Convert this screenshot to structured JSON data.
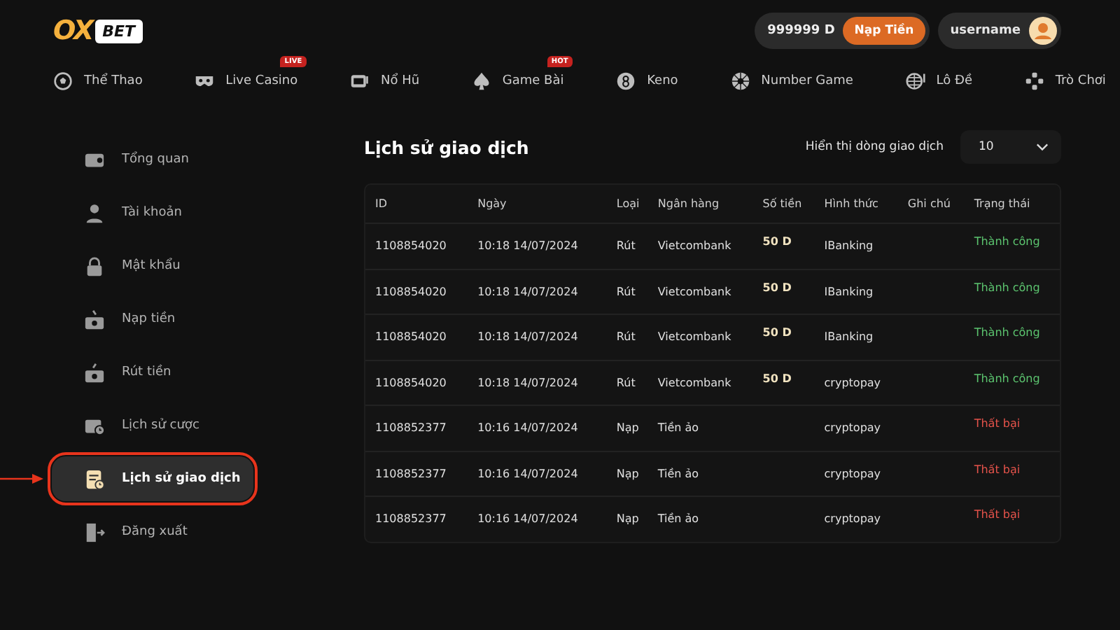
{
  "logo": {
    "first": "OX",
    "second": "BET"
  },
  "balance": {
    "amount": "999999 D",
    "deposit_button": "Nạp Tiền"
  },
  "user": {
    "name": "username"
  },
  "nav": [
    {
      "label": "Thể Thao"
    },
    {
      "label": "Live Casino",
      "badge": "LIVE"
    },
    {
      "label": "Nổ Hũ"
    },
    {
      "label": "Game Bài",
      "badge": "HOT"
    },
    {
      "label": "Keno"
    },
    {
      "label": "Number Game"
    },
    {
      "label": "Lô Đề"
    },
    {
      "label": "Trò Chơi"
    }
  ],
  "sidebar": {
    "items": [
      {
        "label": "Tổng quan",
        "selected": false,
        "highlighted": false
      },
      {
        "label": "Tài khoản",
        "selected": false,
        "highlighted": false
      },
      {
        "label": "Mật khẩu",
        "selected": false,
        "highlighted": false
      },
      {
        "label": "Nạp tiền",
        "selected": false,
        "highlighted": false
      },
      {
        "label": "Rút tiền",
        "selected": false,
        "highlighted": false
      },
      {
        "label": "Lịch sử cược",
        "selected": false,
        "highlighted": false
      },
      {
        "label": "Lịch sử giao dịch",
        "selected": true,
        "highlighted": true
      },
      {
        "label": "Đăng xuất",
        "selected": false,
        "highlighted": false
      }
    ]
  },
  "page_title": "Lịch sử giao dịch",
  "rows_per_page": {
    "label": "Hiển thị dòng giao dịch",
    "value": "10"
  },
  "table": {
    "columns": [
      "ID",
      "Ngày",
      "Loại",
      "Ngân hàng",
      "Số tiền",
      "Hình thức",
      "Ghi chú",
      "Trạng thái"
    ],
    "rows": [
      {
        "id": "1108854020",
        "date": "10:18 14/07/2024",
        "type": "Rút",
        "bank": "Vietcombank",
        "amount": "50 D",
        "method": "IBanking",
        "status": "Thành công",
        "color": "#5cc46f"
      },
      {
        "id": "1108854020",
        "date": "10:18 14/07/2024",
        "type": "Rút",
        "bank": "Vietcombank",
        "amount": "50 D",
        "method": "IBanking",
        "status": "Thành công",
        "color": "#5cc46f"
      },
      {
        "id": "1108854020",
        "date": "10:18 14/07/2024",
        "type": "Rút",
        "bank": "Vietcombank",
        "amount": "50 D",
        "method": "IBanking",
        "status": "Thành công",
        "color": "#5cc46f"
      },
      {
        "id": "1108854020",
        "date": "10:18 14/07/2024",
        "type": "Rút",
        "bank": "Vietcombank",
        "amount": "50 D",
        "method": "cryptopay",
        "status": "Thành công",
        "color": "#5cc46f"
      },
      {
        "id": "1108852377",
        "date": "10:16 14/07/2024",
        "type": "Nạp",
        "bank": "Tiền ảo",
        "method": "cryptopay",
        "status": "Thất bại",
        "color": "#e5534b"
      },
      {
        "id": "1108852377",
        "date": "10:16 14/07/2024",
        "type": "Nạp",
        "bank": "Tiền ảo",
        "method": "cryptopay",
        "status": "Thất bại",
        "color": "#e5534b"
      },
      {
        "id": "1108852377",
        "date": "10:16 14/07/2024",
        "type": "Nạp",
        "bank": "Tiền ảo",
        "method": "cryptopay",
        "status": "Thất bại",
        "color": "#e5534b"
      }
    ]
  }
}
